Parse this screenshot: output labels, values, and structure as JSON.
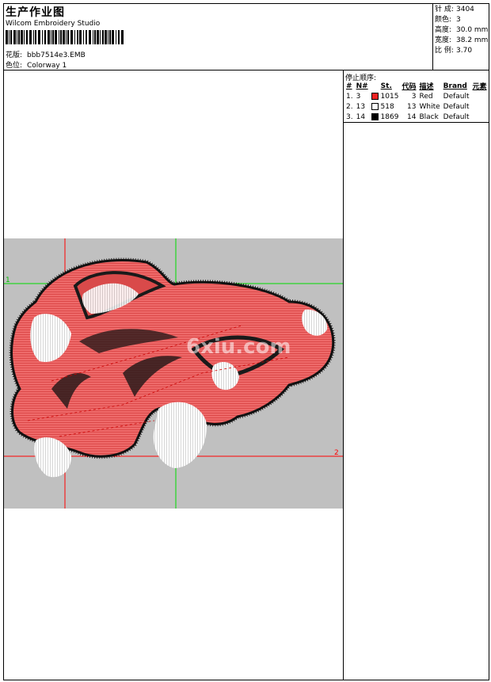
{
  "header": {
    "title": "生产作业图",
    "software": "Wilcom Embroidery Studio",
    "design_label": "花版:",
    "design_value": "bbb7514e3.EMB",
    "colorway_label": "色位:",
    "colorway_value": "Colorway 1"
  },
  "stats": [
    {
      "label": "针 成:",
      "value": "3404"
    },
    {
      "label": "颜色:",
      "value": "3"
    },
    {
      "label": "高度:",
      "value": "30.0 mm"
    },
    {
      "label": "宽度:",
      "value": "38.2 mm"
    },
    {
      "label": "比 例:",
      "value": "3.70"
    }
  ],
  "stop_sequence": {
    "title": "停止顺序:",
    "headers": [
      "#",
      "N#",
      "St.",
      "代码",
      "描述",
      "Brand",
      "元素"
    ],
    "rows": [
      {
        "idx": "1.",
        "n": "3",
        "color": "#ee2222",
        "st": "1015",
        "code": "3",
        "desc": "Red",
        "brand": "Default"
      },
      {
        "idx": "2.",
        "n": "13",
        "color": "#ffffff",
        "st": "518",
        "code": "13",
        "desc": "White",
        "brand": "Default"
      },
      {
        "idx": "3.",
        "n": "14",
        "color": "#000000",
        "st": "1869",
        "code": "14",
        "desc": "Black",
        "brand": "Default"
      }
    ]
  },
  "preview": {
    "watermark": "6xiu.com",
    "marker_1": "1",
    "marker_2": "2",
    "colors": {
      "background": "#c0c0c0",
      "fill": "#e65050",
      "guide_red": "#ff0000",
      "guide_green": "#00e000"
    }
  }
}
